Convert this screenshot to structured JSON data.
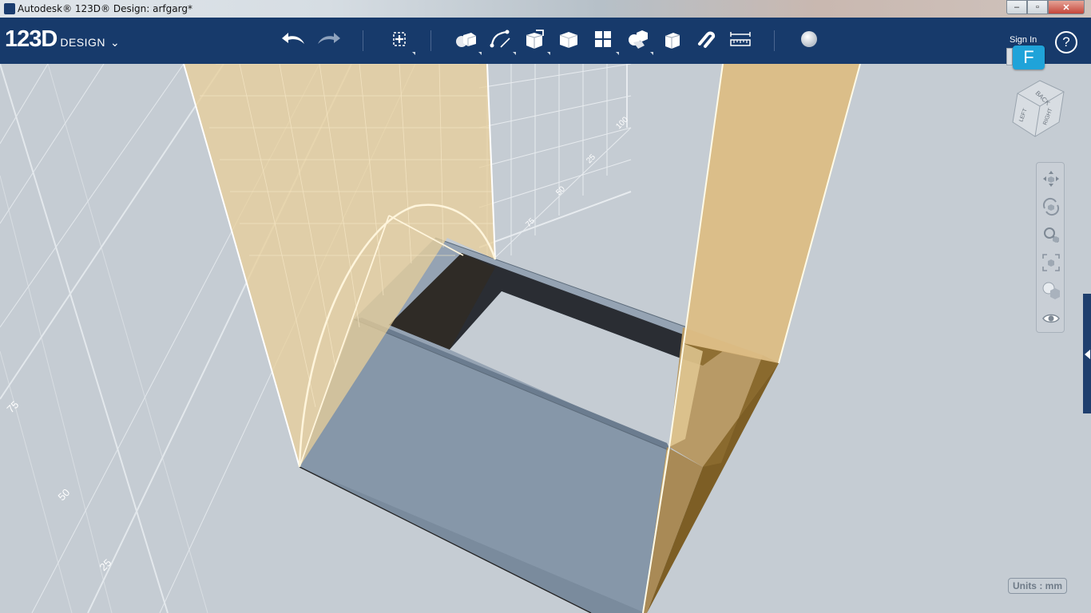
{
  "window": {
    "title": "Autodesk® 123D® Design: arfgarg*",
    "controls": {
      "minimize": "‒",
      "maximize": "▫",
      "close": "✕"
    }
  },
  "toolbar": {
    "logo_number": "123D",
    "logo_word": "DESIGN",
    "logo_menu_icon": "chevron-down-icon",
    "buttons": [
      {
        "name": "undo-button",
        "icon": "undo-arrow-icon"
      },
      {
        "name": "redo-button",
        "icon": "redo-arrow-icon"
      },
      {
        "name": "transform-button",
        "icon": "move-cross-icon"
      },
      {
        "name": "primitives-button",
        "icon": "primitive-shapes-icon"
      },
      {
        "name": "sketch-button",
        "icon": "sketch-curve-icon"
      },
      {
        "name": "construct-button",
        "icon": "construct-box-icon"
      },
      {
        "name": "modify-button",
        "icon": "modify-cube-icon"
      },
      {
        "name": "pattern-button",
        "icon": "pattern-grid-icon"
      },
      {
        "name": "grouping-button",
        "icon": "grouping-icon"
      },
      {
        "name": "combine-button",
        "icon": "combine-icon"
      },
      {
        "name": "snap-button",
        "icon": "snap-magnet-icon"
      },
      {
        "name": "measure-button",
        "icon": "ruler-icon"
      },
      {
        "name": "material-button",
        "icon": "material-sphere-icon"
      }
    ],
    "sign_in": "Sign In",
    "help": "?"
  },
  "viewport": {
    "grid_labels": [
      "75",
      "50",
      "25",
      "75",
      "50",
      "25",
      "100"
    ],
    "colors": {
      "background": "#c5ccd3",
      "sketch_plane": "#e8cf9a",
      "body_gray": "#8898aa",
      "body_tan": "#b89a66",
      "body_dark": "#2a2b2e"
    }
  },
  "view_cube": {
    "faces": [
      "BACK",
      "LEFT",
      "RIGHT"
    ]
  },
  "fusion_badge": "F",
  "navigation": {
    "items": [
      "pan-icon",
      "orbit-icon",
      "zoom-icon",
      "fit-icon",
      "visibility-shading-icon",
      "eye-icon"
    ]
  },
  "status": {
    "units": "Units : mm"
  }
}
